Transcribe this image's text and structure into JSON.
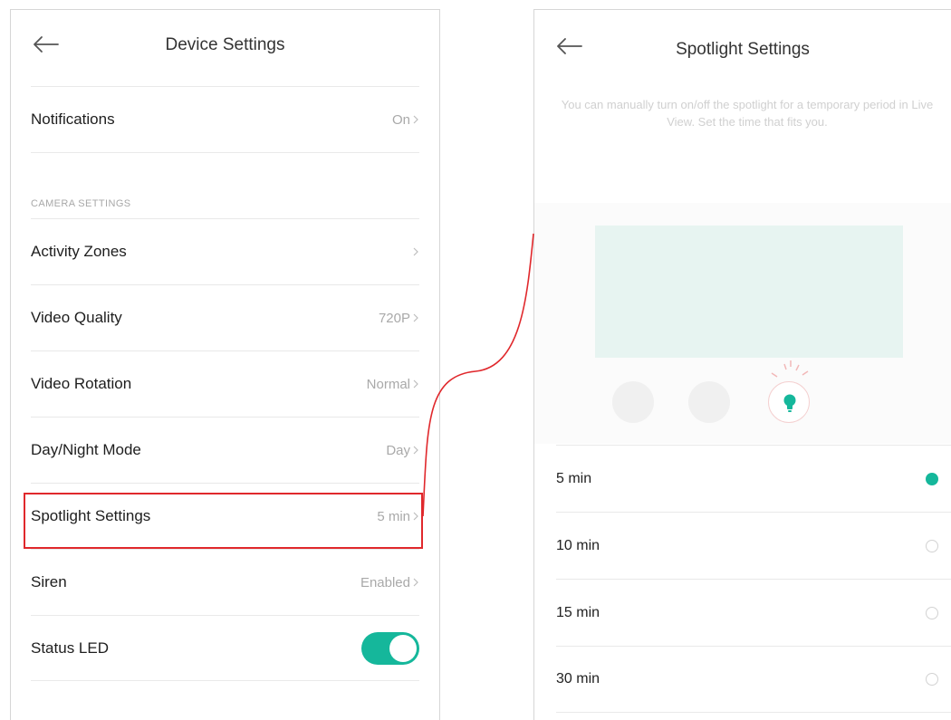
{
  "device_settings": {
    "title": "Device Settings",
    "rows_top": [
      {
        "label": "Notifications",
        "value": "On"
      }
    ],
    "section_header": "CAMERA SETTINGS",
    "rows": [
      {
        "label": "Activity Zones",
        "value": ""
      },
      {
        "label": "Video Quality",
        "value": "720P"
      },
      {
        "label": "Video Rotation",
        "value": "Normal"
      },
      {
        "label": "Day/Night Mode",
        "value": "Day"
      },
      {
        "label": "Spotlight Settings",
        "value": "5 min"
      },
      {
        "label": "Siren",
        "value": "Enabled"
      }
    ],
    "status_led": {
      "label": "Status LED",
      "enabled": true
    }
  },
  "spotlight_settings": {
    "title": "Spotlight Settings",
    "description": "You can manually turn on/off the spotlight for a temporary period in Live View. Set the time that fits you.",
    "options": [
      {
        "label": "5 min",
        "selected": true
      },
      {
        "label": "10 min",
        "selected": false
      },
      {
        "label": "15 min",
        "selected": false
      },
      {
        "label": "30 min",
        "selected": false
      }
    ]
  },
  "colors": {
    "accent": "#15b79b",
    "highlight": "#e0282c"
  },
  "icons": [
    "back-arrow-icon",
    "chevron-right-icon",
    "bulb-icon"
  ]
}
